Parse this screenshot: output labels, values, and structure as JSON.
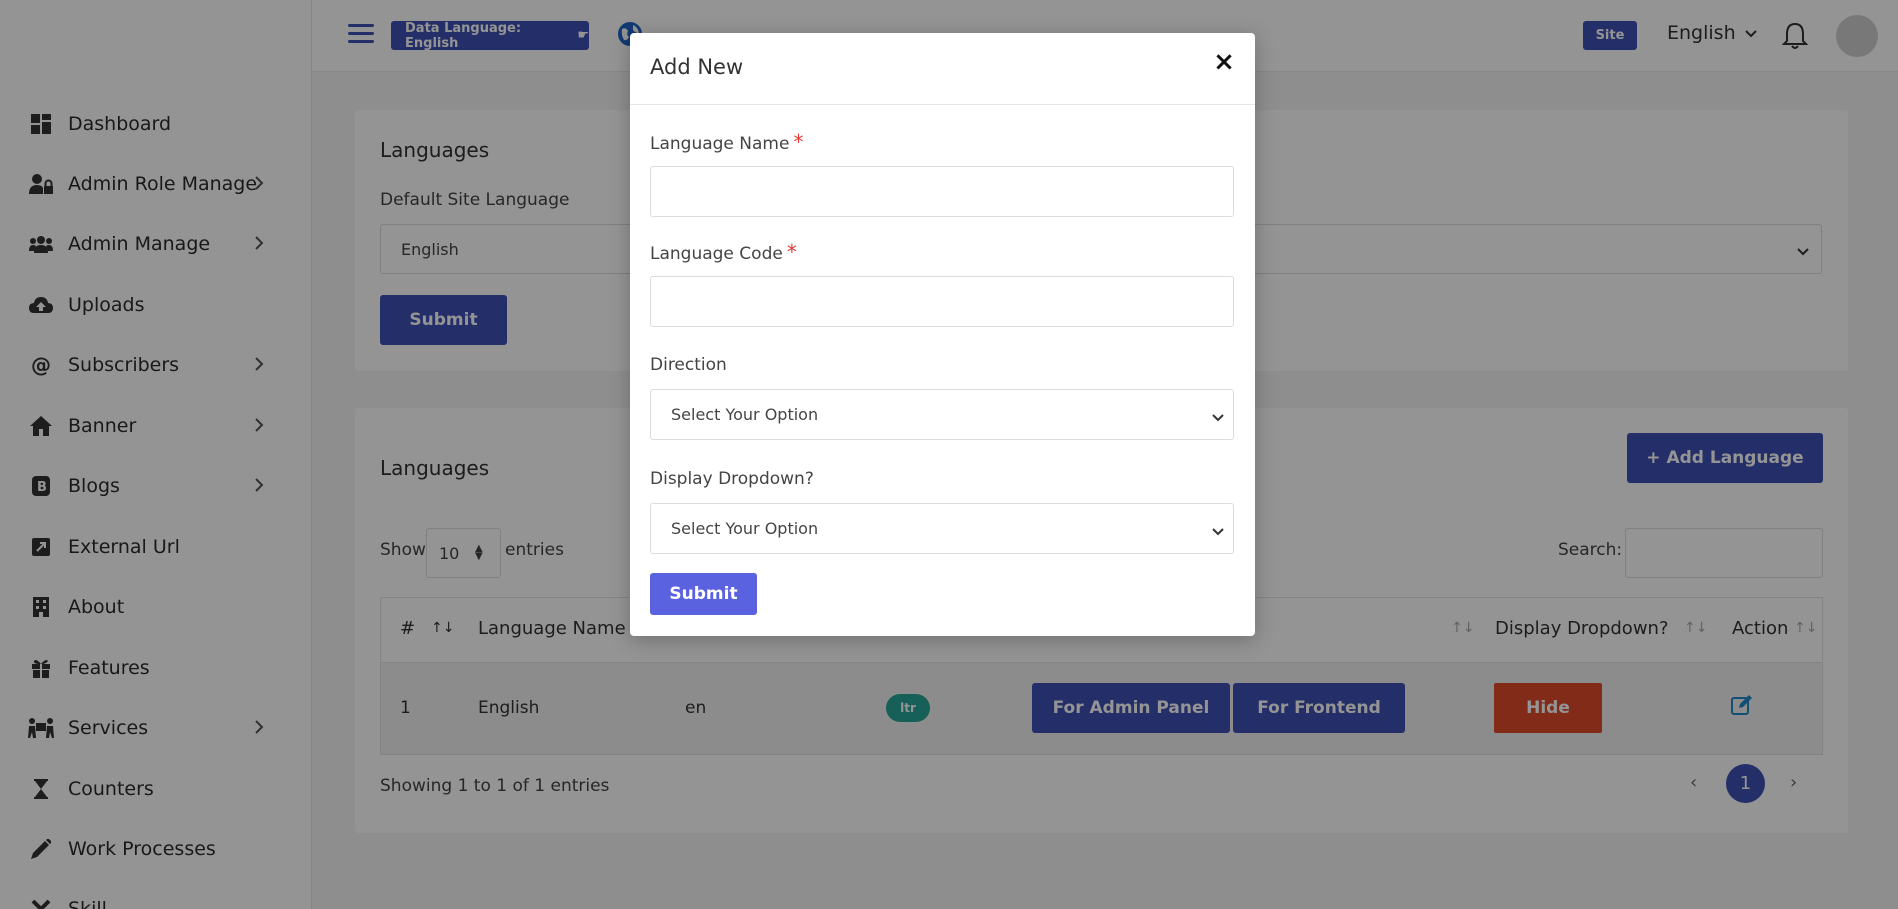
{
  "sidebar": {
    "items": [
      {
        "label": "Dashboard",
        "icon": "dashboard-icon"
      },
      {
        "label": "Admin Role Manage",
        "icon": "user-lock-icon",
        "has_children": true
      },
      {
        "label": "Admin Manage",
        "icon": "users-icon",
        "has_children": true
      },
      {
        "label": "Uploads",
        "icon": "cloud-upload-icon"
      },
      {
        "label": "Subscribers",
        "icon": "at-icon",
        "has_children": true
      },
      {
        "label": "Banner",
        "icon": "home-icon",
        "has_children": true
      },
      {
        "label": "Blogs",
        "icon": "blog-icon",
        "has_children": true
      },
      {
        "label": "External Url",
        "icon": "external-link-icon"
      },
      {
        "label": "About",
        "icon": "building-icon"
      },
      {
        "label": "Features",
        "icon": "gift-icon"
      },
      {
        "label": "Services",
        "icon": "people-carry-icon",
        "has_children": true
      },
      {
        "label": "Counters",
        "icon": "hourglass-icon"
      },
      {
        "label": "Work Processes",
        "icon": "pen-icon"
      },
      {
        "label": "Skill",
        "icon": "tools-icon"
      }
    ]
  },
  "topbar": {
    "data_language": "Data Language: English",
    "site_badge": "Site",
    "language": "English"
  },
  "settings_card": {
    "title": "Languages",
    "default_label": "Default Site Language",
    "default_value": "English",
    "submit": "Submit"
  },
  "languages_card": {
    "title": "Languages",
    "add_button": "+ Add Language",
    "show_label": "Show",
    "entries_value": "10",
    "entries_label": "entries",
    "search_label": "Search:",
    "columns": [
      "#",
      "Language Name",
      "Display Dropdown?",
      "Action"
    ],
    "rows": [
      {
        "num": "1",
        "name": "English",
        "code": "en",
        "direction": "ltr",
        "admin_btn": "For Admin Panel",
        "frontend_btn": "For Frontend",
        "display_btn": "Hide"
      }
    ],
    "info": "Showing 1 to 1 of 1 entries",
    "prev": "‹",
    "page": "1",
    "next": "›"
  },
  "modal": {
    "title": "Add New",
    "close": "×",
    "name_label": "Language Name",
    "code_label": "Language Code",
    "required_mark": "*",
    "direction_label": "Direction",
    "direction_value": "Select Your Option",
    "dropdown_label": "Display Dropdown?",
    "dropdown_value": "Select Your Option",
    "submit": "Submit"
  },
  "colors": {
    "primary": "#3f51b5",
    "modal_submit": "#5b62e0",
    "danger": "#e24a2b",
    "ltr_badge": "#28a69a",
    "required": "#e53935"
  }
}
